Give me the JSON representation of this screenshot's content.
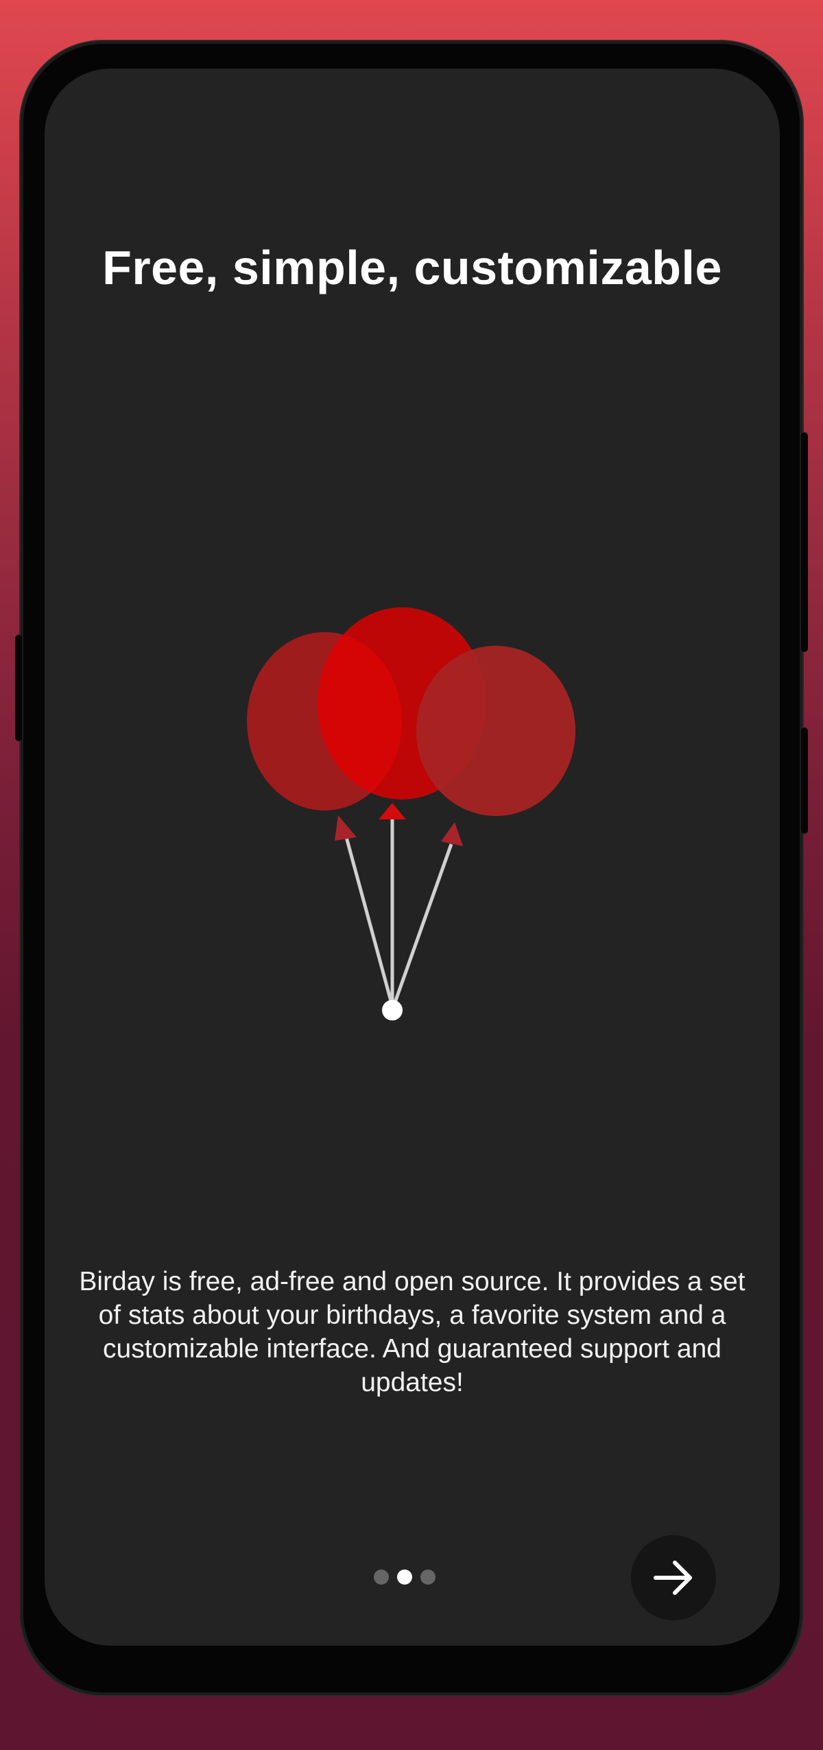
{
  "onboarding": {
    "title": "Free, simple, customizable",
    "description": "Birday is free, ad-free and open source. It provides a set of stats about your birthdays, a favorite system and a customizable interface. And guaranteed support and updates!",
    "pager": {
      "page_count": 3,
      "active_page": 2
    },
    "next_button": {
      "icon": "arrow-right-icon"
    },
    "illustration": {
      "icon": "balloons-icon"
    }
  },
  "colors": {
    "background_top": "#e0474f",
    "background_bottom": "#5e1630",
    "screen": "#232323",
    "balloon_red": "#e00000",
    "balloon_dark": "#a31c1c",
    "text": "#ffffff"
  }
}
